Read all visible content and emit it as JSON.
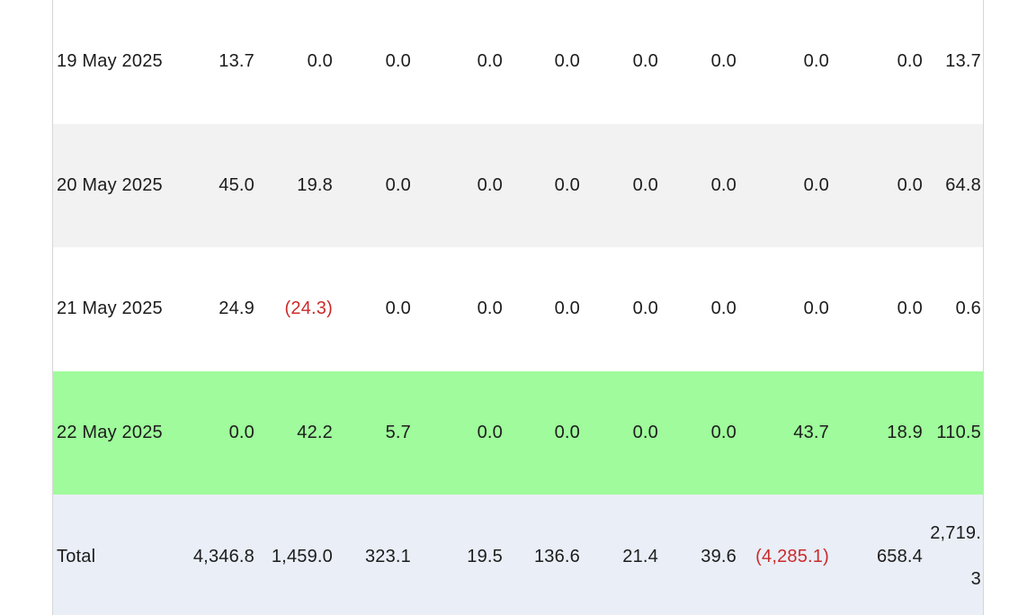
{
  "table": {
    "rows": [
      {
        "date": "19 May 2025",
        "cells": [
          {
            "text": "13.7"
          },
          {
            "text": "0.0"
          },
          {
            "text": "0.0"
          },
          {
            "text": "0.0"
          },
          {
            "text": "0.0"
          },
          {
            "text": "0.0"
          },
          {
            "text": "0.0"
          },
          {
            "text": "0.0"
          },
          {
            "text": "0.0"
          },
          {
            "text": "13.7"
          }
        ]
      },
      {
        "date": "20 May 2025",
        "cells": [
          {
            "text": "45.0"
          },
          {
            "text": "19.8"
          },
          {
            "text": "0.0"
          },
          {
            "text": "0.0"
          },
          {
            "text": "0.0"
          },
          {
            "text": "0.0"
          },
          {
            "text": "0.0"
          },
          {
            "text": "0.0"
          },
          {
            "text": "0.0"
          },
          {
            "text": "64.8"
          }
        ]
      },
      {
        "date": "21 May 2025",
        "cells": [
          {
            "text": "24.9"
          },
          {
            "text": "(24.3)",
            "negative": true
          },
          {
            "text": "0.0"
          },
          {
            "text": "0.0"
          },
          {
            "text": "0.0"
          },
          {
            "text": "0.0"
          },
          {
            "text": "0.0"
          },
          {
            "text": "0.0"
          },
          {
            "text": "0.0"
          },
          {
            "text": "0.6"
          }
        ]
      },
      {
        "date": "22 May 2025",
        "highlighted": true,
        "cells": [
          {
            "text": "0.0"
          },
          {
            "text": "42.2"
          },
          {
            "text": "5.7"
          },
          {
            "text": "0.0"
          },
          {
            "text": "0.0"
          },
          {
            "text": "0.0"
          },
          {
            "text": "0.0"
          },
          {
            "text": "43.7"
          },
          {
            "text": "18.9"
          },
          {
            "text": "110.5"
          }
        ]
      }
    ],
    "total": {
      "label": "Total",
      "cells": [
        {
          "text": "4,346.8"
        },
        {
          "text": "1,459.0"
        },
        {
          "text": "323.1"
        },
        {
          "text": "19.5"
        },
        {
          "text": "136.6"
        },
        {
          "text": "21.4"
        },
        {
          "text": "39.6"
        },
        {
          "text": "(4,285.1)",
          "negative": true
        },
        {
          "text": "658.4"
        },
        {
          "text": "2,719.3"
        }
      ]
    }
  },
  "colors": {
    "highlight_row": "#9ffb9b",
    "alternate_row": "#f2f2f2",
    "total_row": "#e9eef7",
    "negative_text": "#cc2b2b"
  }
}
